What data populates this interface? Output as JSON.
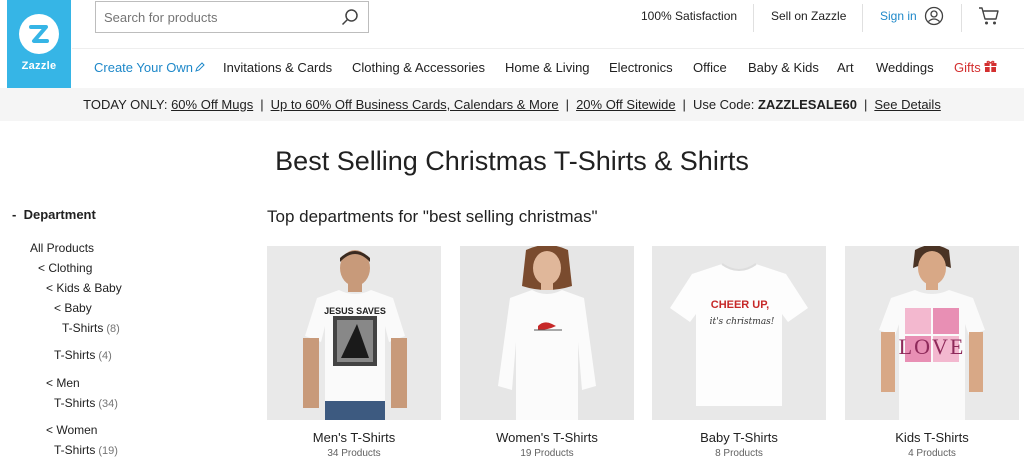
{
  "logo": {
    "text": "Zazzle",
    "color": "#36b5e6"
  },
  "search": {
    "placeholder": "Search for products"
  },
  "top_links": {
    "satisfaction": "100% Satisfaction",
    "sell": "Sell on Zazzle",
    "signin": "Sign in"
  },
  "nav": {
    "items": [
      "Create Your Own",
      "Invitations & Cards",
      "Clothing & Accessories",
      "Home & Living",
      "Electronics",
      "Office",
      "Baby & Kids",
      "Art",
      "Weddings",
      "Gifts"
    ]
  },
  "promo": {
    "prefix": "TODAY ONLY:",
    "link1": "60% Off Mugs",
    "link2": "Up to 60% Off Business Cards, Calendars & More",
    "link3": "20% Off Sitewide",
    "code_prefix": "Use Code:",
    "code": "ZAZZLESALE60",
    "details": "See Details",
    "sep": "|"
  },
  "page_title": "Best Selling Christmas T-Shirts & Shirts",
  "sidebar": {
    "heading_toggle": "-",
    "heading": "Department",
    "items": [
      {
        "label": "All Products",
        "count": ""
      },
      {
        "label": "< Clothing",
        "count": ""
      },
      {
        "label": "< Kids & Baby",
        "count": ""
      },
      {
        "label": "< Baby",
        "count": ""
      },
      {
        "label": "T-Shirts",
        "count": "(8)"
      },
      {
        "label": "T-Shirts",
        "count": "(4)"
      },
      {
        "label": "< Men",
        "count": ""
      },
      {
        "label": "T-Shirts",
        "count": "(34)"
      },
      {
        "label": "< Women",
        "count": ""
      },
      {
        "label": "T-Shirts",
        "count": "(19)"
      }
    ]
  },
  "subtitle": "Top departments for \"best selling christmas\"",
  "cards": [
    {
      "name": "Men's T-Shirts",
      "count": "34 Products",
      "shirt_text": "JESUS SAVES"
    },
    {
      "name": "Women's T-Shirts",
      "count": "19 Products",
      "shirt_text": ""
    },
    {
      "name": "Baby T-Shirts",
      "count": "8 Products",
      "shirt_text": "CHEER UP,",
      "shirt_text2": "it's christmas!"
    },
    {
      "name": "Kids T-Shirts",
      "count": "4 Products",
      "shirt_text": "LOVE"
    }
  ],
  "icons": [
    "zazzle-logo-icon",
    "search-icon",
    "account-icon",
    "cart-icon",
    "pencil-icon",
    "gift-icon"
  ],
  "colors": {
    "accent": "#1e88c9",
    "gifts": "#d32f2f",
    "promo_bg": "#f5f5f5"
  }
}
